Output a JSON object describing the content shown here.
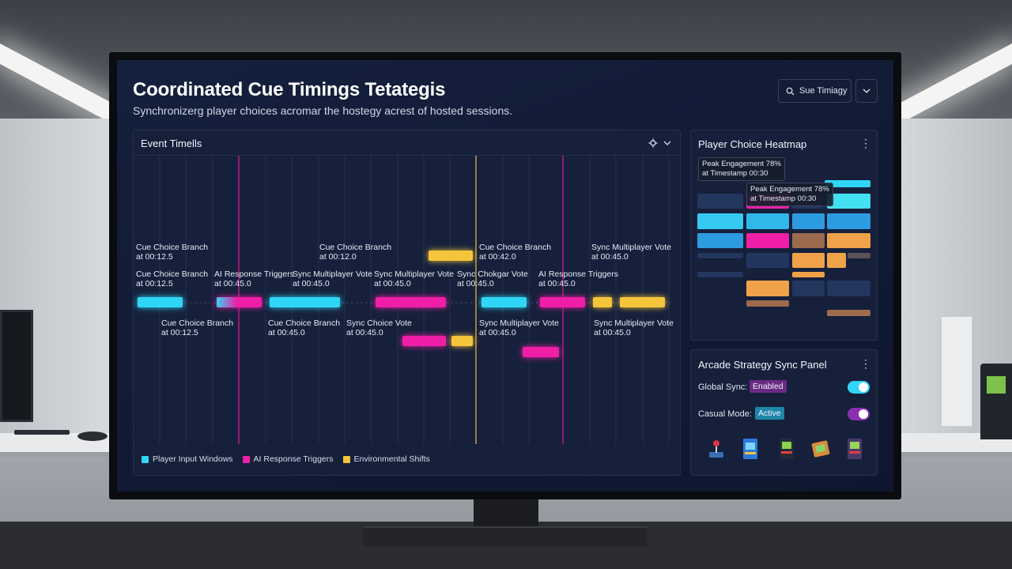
{
  "header": {
    "title": "Coordinated Cue Timings Tetategis",
    "subtitle": "Synchronizerg player choices acromar the hostegy acrest of hosted sessions.",
    "search_label": "Sue Timiagy"
  },
  "timeline": {
    "title": "Event Timells",
    "labels": {
      "top1": [
        "Cue Choice Branch",
        "at 00:12.5"
      ],
      "top2": [
        "Cue Choice Branch",
        "at 00:12.0"
      ],
      "top3": [
        "Cue Choice Branch",
        "at 00:42.0"
      ],
      "top4": [
        "Sync Multiplayer Vote",
        "at 00:45.0"
      ],
      "mid1": [
        "Cue Choice Branch",
        "at 00:12.5"
      ],
      "mid2": [
        "AI Response Triggers",
        "at 00:45.0"
      ],
      "mid3": [
        "Sync Multiplayer Vote",
        "at 00:45.0"
      ],
      "mid4": [
        "Sync Multiplayer Vote",
        "at 00:45.0"
      ],
      "mid5": [
        "Sync Chokgar Vote",
        "at 00:45.0"
      ],
      "mid6": [
        "AI Response Triggers",
        "at 00:45.0"
      ],
      "low1": [
        "Cue Choice Branch",
        "at 00:12.5"
      ],
      "low2": [
        "Cue Choice Branch",
        "at 00:45.0"
      ],
      "low3": [
        "Sync Choice Vote",
        "at 00:45.0"
      ],
      "low4": [
        "Sync Multiplayer Vote",
        "at 00:45.0"
      ],
      "low5": [
        "Sync Multiplayer Vote",
        "at 00:45.0"
      ]
    },
    "legend": [
      {
        "label": "Player Input Windows",
        "color": "#2fd6f5"
      },
      {
        "label": "AI Response Triggers",
        "color": "#ee1fa6"
      },
      {
        "label": "Environmental Shifts",
        "color": "#f5c53b"
      }
    ]
  },
  "heatmap": {
    "title": "Player Choice Heatmap",
    "tooltip1": [
      "Peak Engagement 78%",
      "at Timestamp 00:30"
    ],
    "tooltip2": [
      "Peak Engagement 78%",
      "at Timestamp 00:30"
    ]
  },
  "sync_panel": {
    "title": "Arcade Strategy Sync Panel",
    "global_sync_label": "Global Sync:",
    "global_sync_status": "Enabled",
    "casual_mode_label": "Casual Mode:",
    "casual_mode_status": "Active",
    "icons": [
      "joystick-icon",
      "arcade-cabinet-icon",
      "arcade-cabinet-icon",
      "game-cartridge-icon",
      "arcade-cabinet-icon"
    ]
  },
  "colors": {
    "cyan": "#2fd6f5",
    "magenta": "#ee1fa6",
    "yellow": "#f5c53b",
    "orange": "#f0a24a",
    "blue": "#2d9be0",
    "brown": "#9c6b4e",
    "navy": "#23365e"
  }
}
